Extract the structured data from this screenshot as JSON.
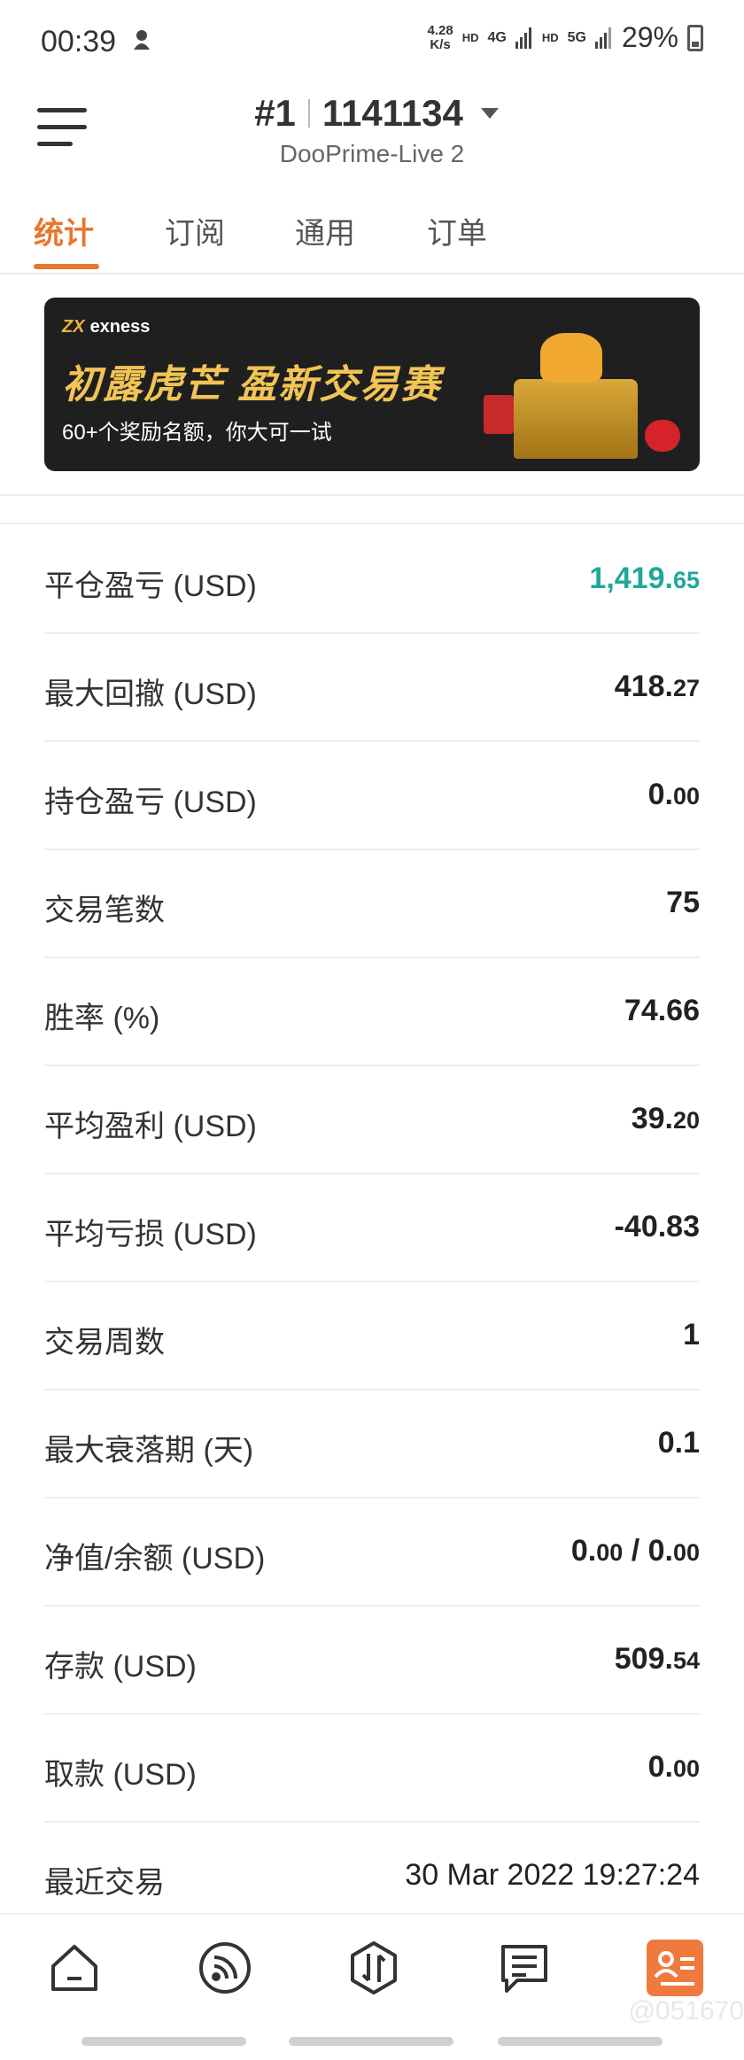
{
  "status_bar": {
    "time": "00:39",
    "speed_value": "4.28",
    "speed_unit": "K/s",
    "hd1": "HD",
    "net1": "4G",
    "hd2": "HD",
    "net2": "5G",
    "battery": "29%"
  },
  "header": {
    "account_prefix": "#1",
    "account_number": "1141134",
    "server": "DooPrime-Live 2"
  },
  "tabs": [
    {
      "label": "统计",
      "active": true
    },
    {
      "label": "订阅",
      "active": false
    },
    {
      "label": "通用",
      "active": false
    },
    {
      "label": "订单",
      "active": false
    }
  ],
  "banner": {
    "brand": "exness",
    "title": "初露虎芒 盈新交易赛",
    "subtitle": "60+个奖励名额，你大可一试"
  },
  "stats": [
    {
      "label": "平仓盈亏 (USD)",
      "int": "1,419.",
      "dec": "65",
      "green": true
    },
    {
      "label": "最大回撤 (USD)",
      "int": "418.",
      "dec": "27"
    },
    {
      "label": "持仓盈亏 (USD)",
      "int": "0.",
      "dec": "00"
    },
    {
      "label": "交易笔数",
      "int": "75",
      "dec": ""
    },
    {
      "label": "胜率 (%)",
      "int": "74.66",
      "dec": ""
    },
    {
      "label": "平均盈利 (USD)",
      "int": "39.",
      "dec": "20"
    },
    {
      "label": "平均亏损 (USD)",
      "int": "-40.83",
      "dec": ""
    },
    {
      "label": "交易周数",
      "int": "1",
      "dec": ""
    },
    {
      "label": "最大衰落期 (天)",
      "int": "0.1",
      "dec": ""
    },
    {
      "label": "净值/余额 (USD)",
      "int": "0.",
      "dec": "00",
      "int2": " / 0.",
      "dec2": "00"
    },
    {
      "label": "存款 (USD)",
      "int": "509.",
      "dec": "54"
    },
    {
      "label": "取款 (USD)",
      "int": "0.",
      "dec": "00"
    },
    {
      "label": "最近交易",
      "int": "30 Mar 2022 19:27:24",
      "dec": ""
    }
  ],
  "bottom_nav": [
    {
      "icon": "home-icon"
    },
    {
      "icon": "signal-feed-icon"
    },
    {
      "icon": "trade-icon"
    },
    {
      "icon": "news-icon"
    },
    {
      "icon": "profile-card-icon",
      "active": true
    }
  ],
  "watermark": "@051670",
  "colors": {
    "accent": "#e8762c",
    "profit": "#1fa898"
  }
}
